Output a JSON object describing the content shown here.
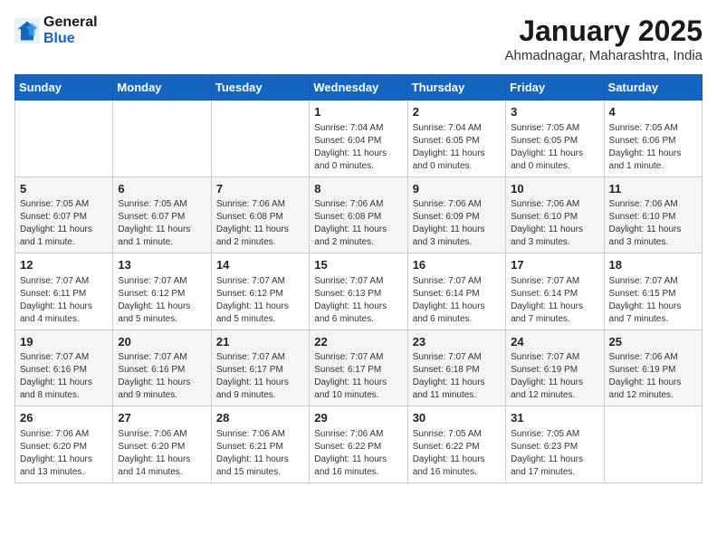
{
  "header": {
    "logo_line1": "General",
    "logo_line2": "Blue",
    "month": "January 2025",
    "location": "Ahmadnagar, Maharashtra, India"
  },
  "weekdays": [
    "Sunday",
    "Monday",
    "Tuesday",
    "Wednesday",
    "Thursday",
    "Friday",
    "Saturday"
  ],
  "weeks": [
    [
      {
        "num": "",
        "info": ""
      },
      {
        "num": "",
        "info": ""
      },
      {
        "num": "",
        "info": ""
      },
      {
        "num": "1",
        "info": "Sunrise: 7:04 AM\nSunset: 6:04 PM\nDaylight: 11 hours\nand 0 minutes."
      },
      {
        "num": "2",
        "info": "Sunrise: 7:04 AM\nSunset: 6:05 PM\nDaylight: 11 hours\nand 0 minutes."
      },
      {
        "num": "3",
        "info": "Sunrise: 7:05 AM\nSunset: 6:05 PM\nDaylight: 11 hours\nand 0 minutes."
      },
      {
        "num": "4",
        "info": "Sunrise: 7:05 AM\nSunset: 6:06 PM\nDaylight: 11 hours\nand 1 minute."
      }
    ],
    [
      {
        "num": "5",
        "info": "Sunrise: 7:05 AM\nSunset: 6:07 PM\nDaylight: 11 hours\nand 1 minute."
      },
      {
        "num": "6",
        "info": "Sunrise: 7:05 AM\nSunset: 6:07 PM\nDaylight: 11 hours\nand 1 minute."
      },
      {
        "num": "7",
        "info": "Sunrise: 7:06 AM\nSunset: 6:08 PM\nDaylight: 11 hours\nand 2 minutes."
      },
      {
        "num": "8",
        "info": "Sunrise: 7:06 AM\nSunset: 6:08 PM\nDaylight: 11 hours\nand 2 minutes."
      },
      {
        "num": "9",
        "info": "Sunrise: 7:06 AM\nSunset: 6:09 PM\nDaylight: 11 hours\nand 3 minutes."
      },
      {
        "num": "10",
        "info": "Sunrise: 7:06 AM\nSunset: 6:10 PM\nDaylight: 11 hours\nand 3 minutes."
      },
      {
        "num": "11",
        "info": "Sunrise: 7:06 AM\nSunset: 6:10 PM\nDaylight: 11 hours\nand 3 minutes."
      }
    ],
    [
      {
        "num": "12",
        "info": "Sunrise: 7:07 AM\nSunset: 6:11 PM\nDaylight: 11 hours\nand 4 minutes."
      },
      {
        "num": "13",
        "info": "Sunrise: 7:07 AM\nSunset: 6:12 PM\nDaylight: 11 hours\nand 5 minutes."
      },
      {
        "num": "14",
        "info": "Sunrise: 7:07 AM\nSunset: 6:12 PM\nDaylight: 11 hours\nand 5 minutes."
      },
      {
        "num": "15",
        "info": "Sunrise: 7:07 AM\nSunset: 6:13 PM\nDaylight: 11 hours\nand 6 minutes."
      },
      {
        "num": "16",
        "info": "Sunrise: 7:07 AM\nSunset: 6:14 PM\nDaylight: 11 hours\nand 6 minutes."
      },
      {
        "num": "17",
        "info": "Sunrise: 7:07 AM\nSunset: 6:14 PM\nDaylight: 11 hours\nand 7 minutes."
      },
      {
        "num": "18",
        "info": "Sunrise: 7:07 AM\nSunset: 6:15 PM\nDaylight: 11 hours\nand 7 minutes."
      }
    ],
    [
      {
        "num": "19",
        "info": "Sunrise: 7:07 AM\nSunset: 6:16 PM\nDaylight: 11 hours\nand 8 minutes."
      },
      {
        "num": "20",
        "info": "Sunrise: 7:07 AM\nSunset: 6:16 PM\nDaylight: 11 hours\nand 9 minutes."
      },
      {
        "num": "21",
        "info": "Sunrise: 7:07 AM\nSunset: 6:17 PM\nDaylight: 11 hours\nand 9 minutes."
      },
      {
        "num": "22",
        "info": "Sunrise: 7:07 AM\nSunset: 6:17 PM\nDaylight: 11 hours\nand 10 minutes."
      },
      {
        "num": "23",
        "info": "Sunrise: 7:07 AM\nSunset: 6:18 PM\nDaylight: 11 hours\nand 11 minutes."
      },
      {
        "num": "24",
        "info": "Sunrise: 7:07 AM\nSunset: 6:19 PM\nDaylight: 11 hours\nand 12 minutes."
      },
      {
        "num": "25",
        "info": "Sunrise: 7:06 AM\nSunset: 6:19 PM\nDaylight: 11 hours\nand 12 minutes."
      }
    ],
    [
      {
        "num": "26",
        "info": "Sunrise: 7:06 AM\nSunset: 6:20 PM\nDaylight: 11 hours\nand 13 minutes."
      },
      {
        "num": "27",
        "info": "Sunrise: 7:06 AM\nSunset: 6:20 PM\nDaylight: 11 hours\nand 14 minutes."
      },
      {
        "num": "28",
        "info": "Sunrise: 7:06 AM\nSunset: 6:21 PM\nDaylight: 11 hours\nand 15 minutes."
      },
      {
        "num": "29",
        "info": "Sunrise: 7:06 AM\nSunset: 6:22 PM\nDaylight: 11 hours\nand 16 minutes."
      },
      {
        "num": "30",
        "info": "Sunrise: 7:05 AM\nSunset: 6:22 PM\nDaylight: 11 hours\nand 16 minutes."
      },
      {
        "num": "31",
        "info": "Sunrise: 7:05 AM\nSunset: 6:23 PM\nDaylight: 11 hours\nand 17 minutes."
      },
      {
        "num": "",
        "info": ""
      }
    ]
  ]
}
